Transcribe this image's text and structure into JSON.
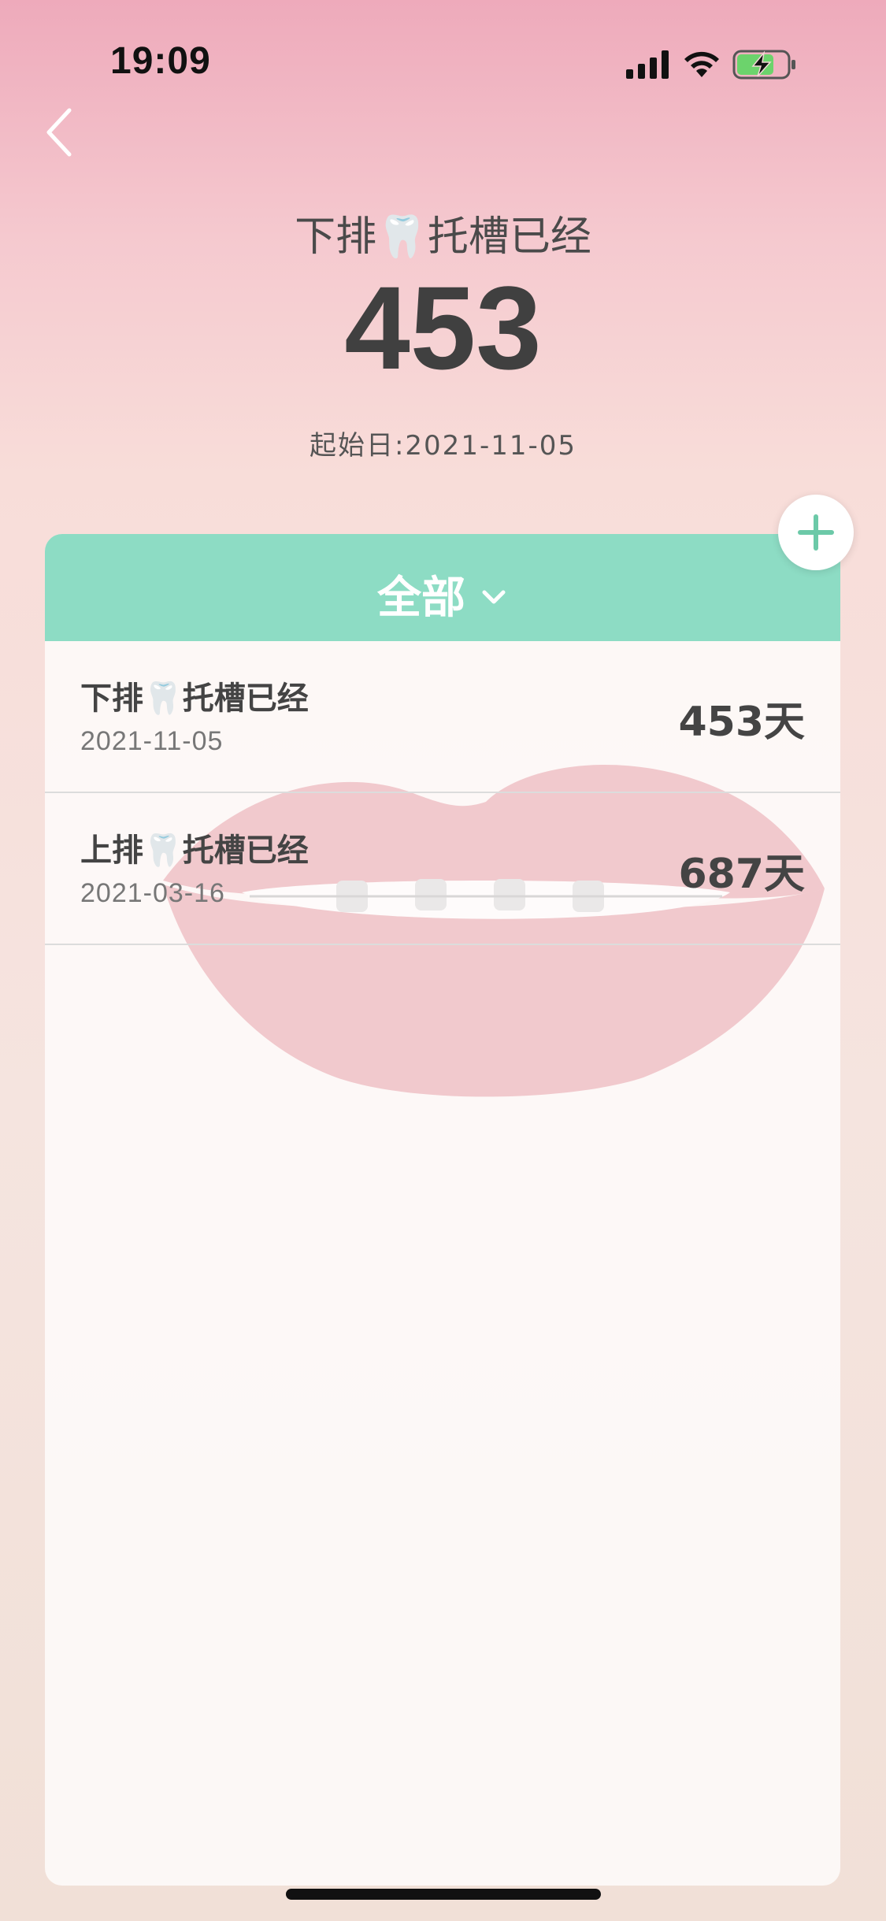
{
  "status_bar": {
    "time": "19:09",
    "icons": [
      "signal-icon",
      "wifi-icon",
      "battery-charging-icon"
    ]
  },
  "header": {
    "title": "下排🦷托槽已经",
    "count": "453",
    "start_date": "起始日:2021-11-05"
  },
  "filter": {
    "label": "全部"
  },
  "items": [
    {
      "title": "下排🦷托槽已经",
      "date": "2021-11-05",
      "days": "453天"
    },
    {
      "title": "上排🦷托槽已经",
      "date": "2021-03-16",
      "days": "687天"
    }
  ],
  "colors": {
    "accent": "#8ddcc4",
    "battery_green": "#6cd36c",
    "text_dark": "#404040"
  }
}
